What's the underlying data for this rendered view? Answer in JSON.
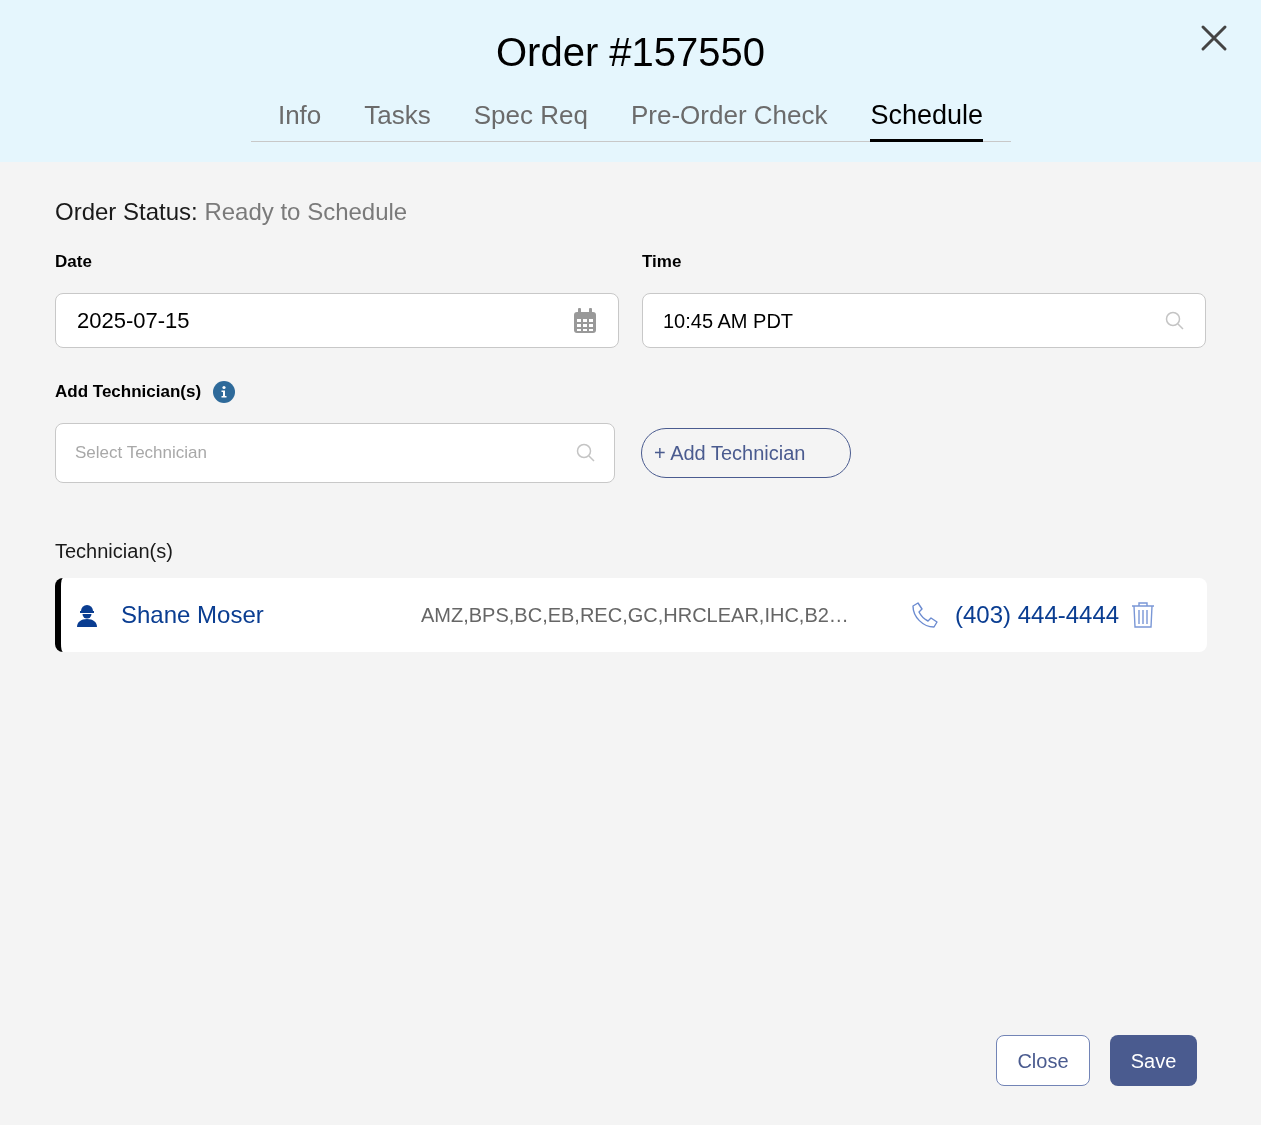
{
  "title": "Order #157550",
  "tabs": [
    {
      "label": "Info",
      "selected": false
    },
    {
      "label": "Tasks",
      "selected": false
    },
    {
      "label": "Spec Req",
      "selected": false
    },
    {
      "label": "Pre-Order Check",
      "selected": false
    },
    {
      "label": "Schedule",
      "selected": true
    }
  ],
  "order_status": {
    "label": "Order Status:",
    "value": "Ready to Schedule"
  },
  "date": {
    "label": "Date",
    "value": "2025-07-15"
  },
  "time": {
    "label": "Time",
    "value": "10:45 AM PDT"
  },
  "add_technicians": {
    "label": "Add Technician(s)",
    "placeholder": "Select Technician",
    "button": "+ Add Technician"
  },
  "technicians": {
    "label": "Technician(s)",
    "rows": [
      {
        "name": "Shane Moser",
        "skills": "AMZ,BPS,BC,EB,REC,GC,HRCLEAR,IHC,B2…",
        "phone": "(403) 444-4444"
      }
    ]
  },
  "buttons": {
    "close": "Close",
    "save": "Save"
  }
}
